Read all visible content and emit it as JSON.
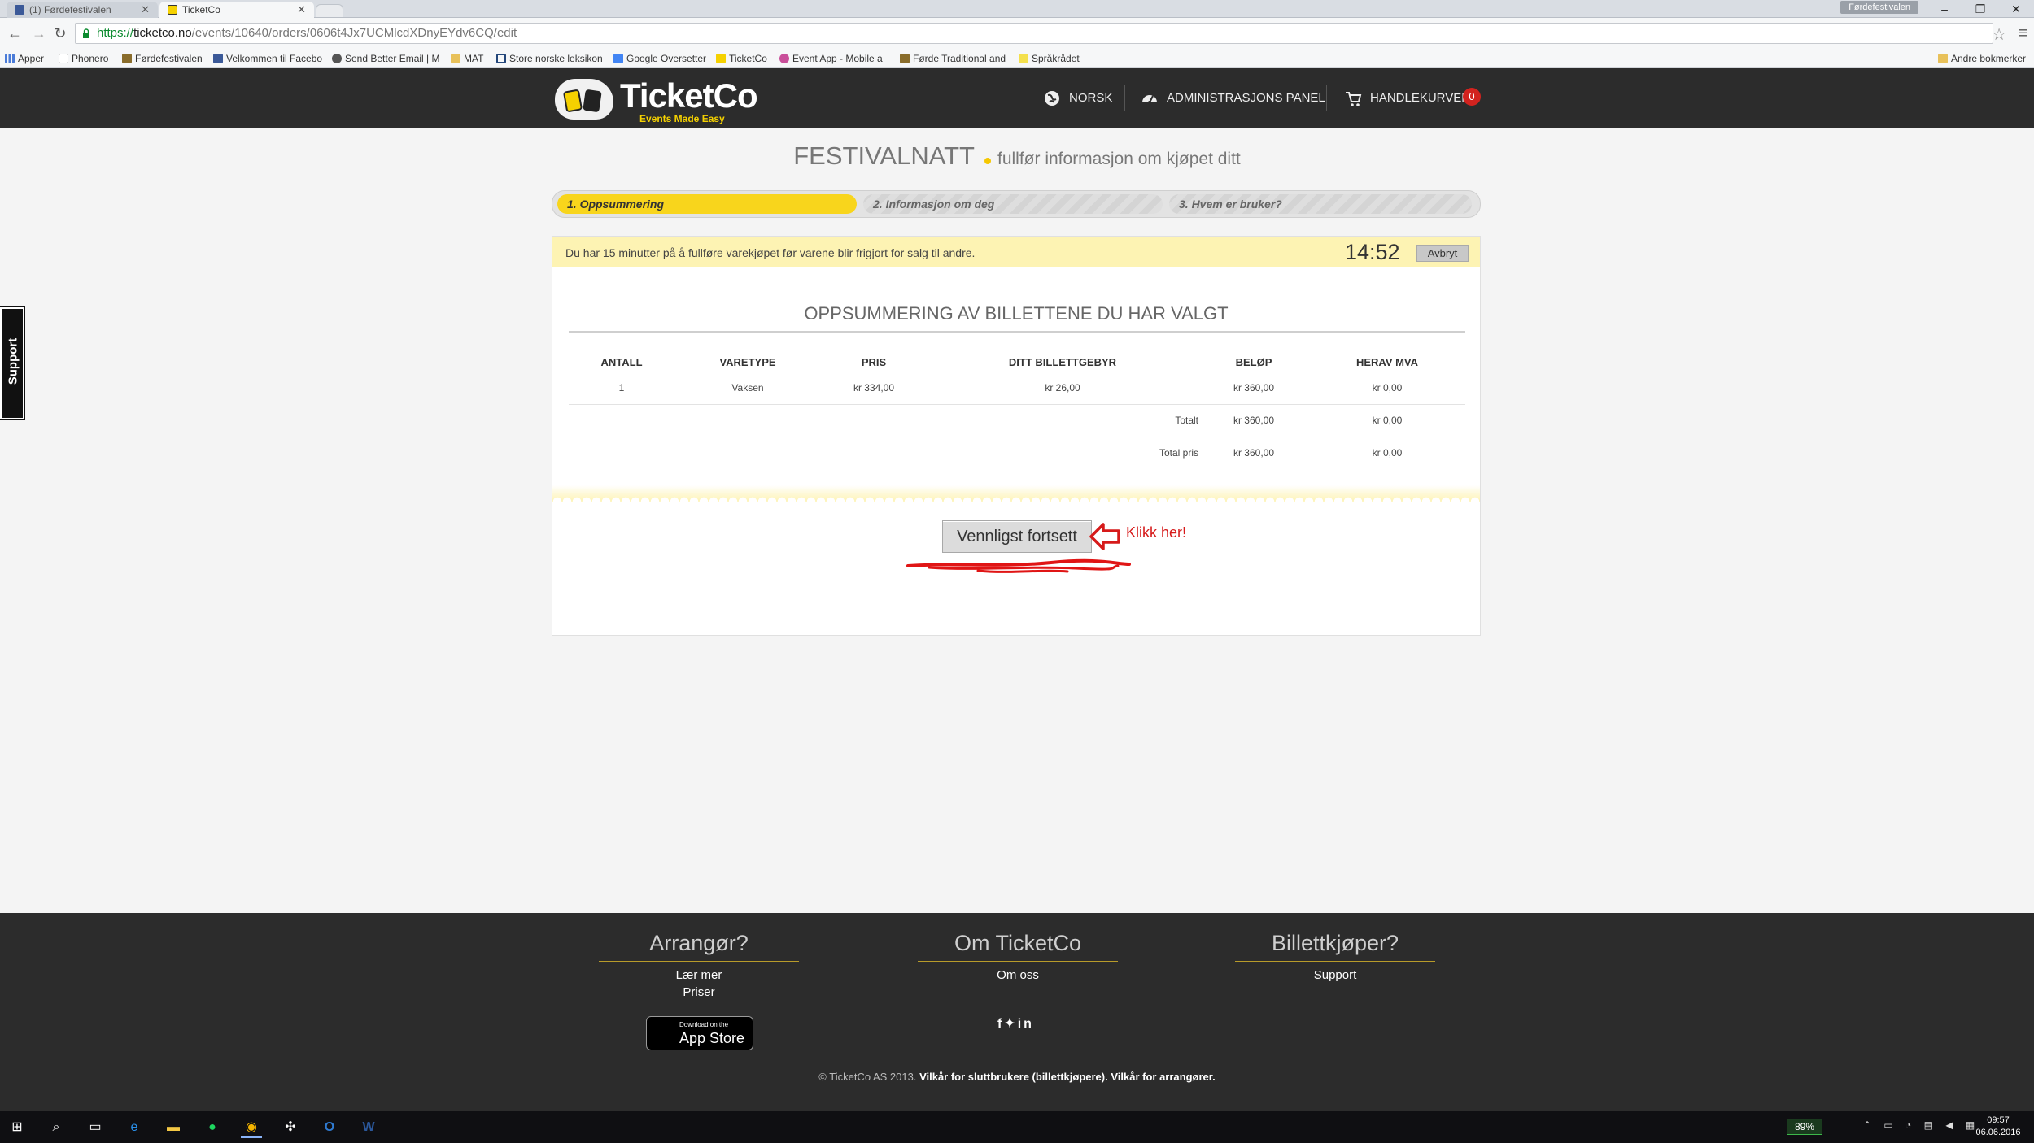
{
  "browser": {
    "tabs": [
      {
        "label": "(1) Førdefestivalen",
        "active": false
      },
      {
        "label": "TicketCo",
        "active": true
      }
    ],
    "profile_chip": "Førdefestivalen",
    "url": {
      "scheme": "https://",
      "host": "ticketco.no",
      "path": "/events/10640/orders/0606t4Jx7UCMlcdXDnyEYdv6CQ/edit"
    },
    "bookmarks": [
      {
        "label": "Apper",
        "icon": "apps-grid-icon"
      },
      {
        "label": "Phonero",
        "icon": "page-icon"
      },
      {
        "label": "Førdefestivalen",
        "icon": "festival-icon"
      },
      {
        "label": "Velkommen til Facebo",
        "icon": "facebook-icon"
      },
      {
        "label": "Send Better Email | M",
        "icon": "email-icon"
      },
      {
        "label": "MAT",
        "icon": "folder-icon"
      },
      {
        "label": "Store norske leksikon",
        "icon": "snl-icon"
      },
      {
        "label": "Google Oversetter",
        "icon": "google-translate-icon"
      },
      {
        "label": "TicketCo",
        "icon": "ticketco-icon"
      },
      {
        "label": "Event App - Mobile a",
        "icon": "event-app-icon"
      },
      {
        "label": "Førde Traditional and",
        "icon": "festival-icon"
      },
      {
        "label": "Språkrådet",
        "icon": "sprakradet-icon"
      }
    ],
    "other_bookmarks": "Andre bokmerker"
  },
  "site": {
    "logo_text": "TicketCo",
    "logo_tagline": "Events Made Easy",
    "nav": {
      "language": "NORSK",
      "admin": "ADMINISTRASJONS PANEL",
      "cart": "HANDLEKURVEN",
      "cart_count": "0"
    },
    "support_tab": "Support"
  },
  "main": {
    "event_name": "FESTIVALNATT",
    "subtitle": "fullfør informasjon om kjøpet ditt",
    "steps": [
      {
        "label": "1. Oppsummering",
        "active": true
      },
      {
        "label": "2. Informasjon om deg",
        "active": false
      },
      {
        "label": "3. Hvem er bruker?",
        "active": false
      }
    ],
    "timer": {
      "message": "Du har 15 minutter på å fullføre varekjøpet før varene blir frigjort for salg til andre.",
      "value": "14:52",
      "cancel_label": "Avbryt"
    },
    "summary": {
      "title": "OPPSUMMERING AV BILLETTENE DU HAR VALGT",
      "columns": [
        "ANTALL",
        "VARETYPE",
        "PRIS",
        "DITT BILLETTGEBYR",
        "BELØP",
        "HERAV MVA"
      ],
      "rows": [
        {
          "antall": "1",
          "varetype": "Vaksen",
          "pris": "kr 334,00",
          "gebyr": "kr 26,00",
          "belop": "kr 360,00",
          "mva": "kr 0,00"
        }
      ],
      "totals": [
        {
          "label": "Totalt",
          "belop": "kr 360,00",
          "mva": "kr 0,00"
        },
        {
          "label": "Total pris",
          "belop": "kr 360,00",
          "mva": "kr 0,00"
        }
      ]
    },
    "continue_label": "Vennligst fortsett",
    "annotation": "Klikk her!"
  },
  "footer": {
    "columns": [
      {
        "title": "Arrangør?",
        "links": [
          "Lær mer",
          "Priser"
        ]
      },
      {
        "title": "Om TicketCo",
        "links": [
          "Om oss"
        ]
      },
      {
        "title": "Billettkjøper?",
        "links": [
          "Support"
        ]
      }
    ],
    "appstore": {
      "line1": "Download on the",
      "line2": "App Store"
    },
    "social": [
      "facebook-icon",
      "twitter-icon",
      "linkedin-icon"
    ],
    "copyright": "© TicketCo AS 2013.",
    "terms_users": "Vilkår for sluttbrukere (billettkjøpere).",
    "terms_organizers": "Vilkår for arrangører."
  },
  "taskbar": {
    "battery": "89%",
    "time": "09:57",
    "date": "06.06.2016"
  }
}
